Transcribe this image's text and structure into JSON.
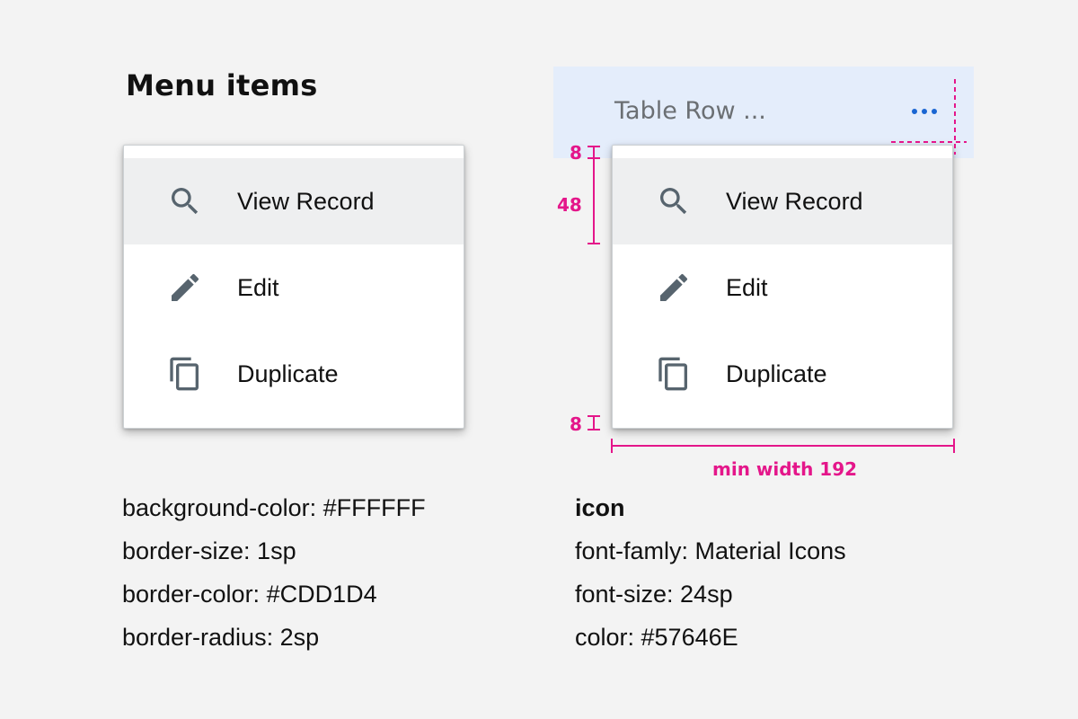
{
  "title": "Menu items",
  "table_row": {
    "label": "Table Row ...",
    "more_icon": "more-horizontal-icon"
  },
  "menu": {
    "items": [
      {
        "label": "View Record",
        "icon": "search-icon",
        "highlighted": true
      },
      {
        "label": "Edit",
        "icon": "pencil-icon",
        "highlighted": false
      },
      {
        "label": "Duplicate",
        "icon": "copy-icon",
        "highlighted": false
      }
    ]
  },
  "specs_left": [
    "background-color: #FFFFFF",
    "border-size: 1sp",
    "border-color: #CDD1D4",
    "border-radius: 2sp"
  ],
  "specs_right": {
    "heading": "icon",
    "lines": [
      "font-famly: Material Icons",
      "font-size: 24sp",
      "color: #57646E"
    ]
  },
  "annotations": {
    "top_padding": "8",
    "item_height": "48",
    "bottom_padding": "8",
    "min_width": "min width 192"
  },
  "colors": {
    "background": "#FFFFFF",
    "border": "#CDD1D4",
    "icon": "#57646E",
    "highlight": "#EEEFF0",
    "annotation": "#E4168A",
    "accent": "#1A66D2"
  }
}
